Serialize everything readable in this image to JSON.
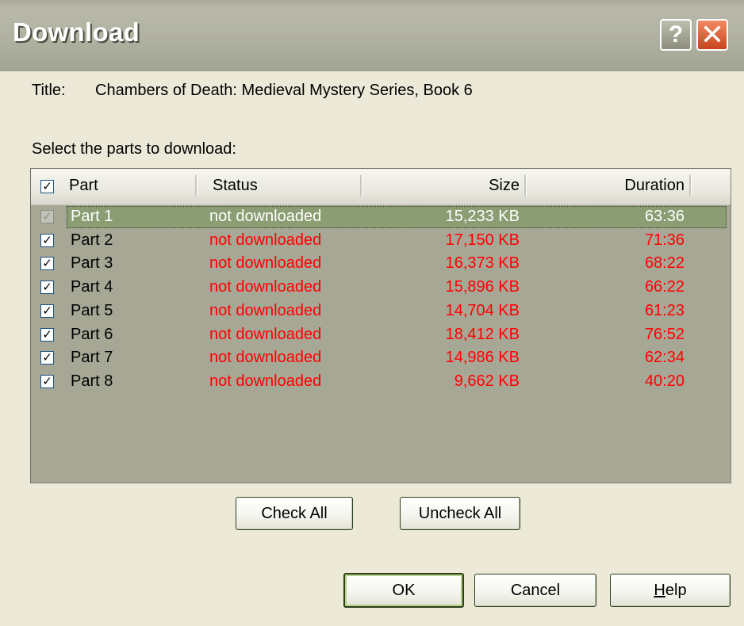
{
  "window": {
    "title": "Download",
    "help_glyph": "?",
    "close_glyph": "✕"
  },
  "info": {
    "title_label": "Title:",
    "title_value": "Chambers of Death: Medieval Mystery Series, Book 6",
    "select_label": "Select the parts to download:"
  },
  "list": {
    "columns": {
      "part": "Part",
      "status": "Status",
      "size": "Size",
      "duration": "Duration"
    },
    "rows": [
      {
        "checked": true,
        "part": "Part 1",
        "status": "not downloaded",
        "size": "15,233 KB",
        "duration": "63:36"
      },
      {
        "checked": true,
        "part": "Part 2",
        "status": "not downloaded",
        "size": "17,150 KB",
        "duration": "71:36"
      },
      {
        "checked": true,
        "part": "Part 3",
        "status": "not downloaded",
        "size": "16,373 KB",
        "duration": "68:22"
      },
      {
        "checked": true,
        "part": "Part 4",
        "status": "not downloaded",
        "size": "15,896 KB",
        "duration": "66:22"
      },
      {
        "checked": true,
        "part": "Part 5",
        "status": "not downloaded",
        "size": "14,704 KB",
        "duration": "61:23"
      },
      {
        "checked": true,
        "part": "Part 6",
        "status": "not downloaded",
        "size": "18,412 KB",
        "duration": "76:52"
      },
      {
        "checked": true,
        "part": "Part 7",
        "status": "not downloaded",
        "size": "14,986 KB",
        "duration": "62:34"
      },
      {
        "checked": true,
        "part": "Part 8",
        "status": "not downloaded",
        "size": "9,662 KB",
        "duration": "40:20"
      }
    ]
  },
  "buttons": {
    "check_all": "Check All",
    "uncheck_all": "Uncheck All",
    "ok": "OK",
    "cancel": "Cancel",
    "help_prefix": "H",
    "help_rest": "elp"
  },
  "colors": {
    "status_red": "#ff0000",
    "selected_text": "#ffffff"
  }
}
